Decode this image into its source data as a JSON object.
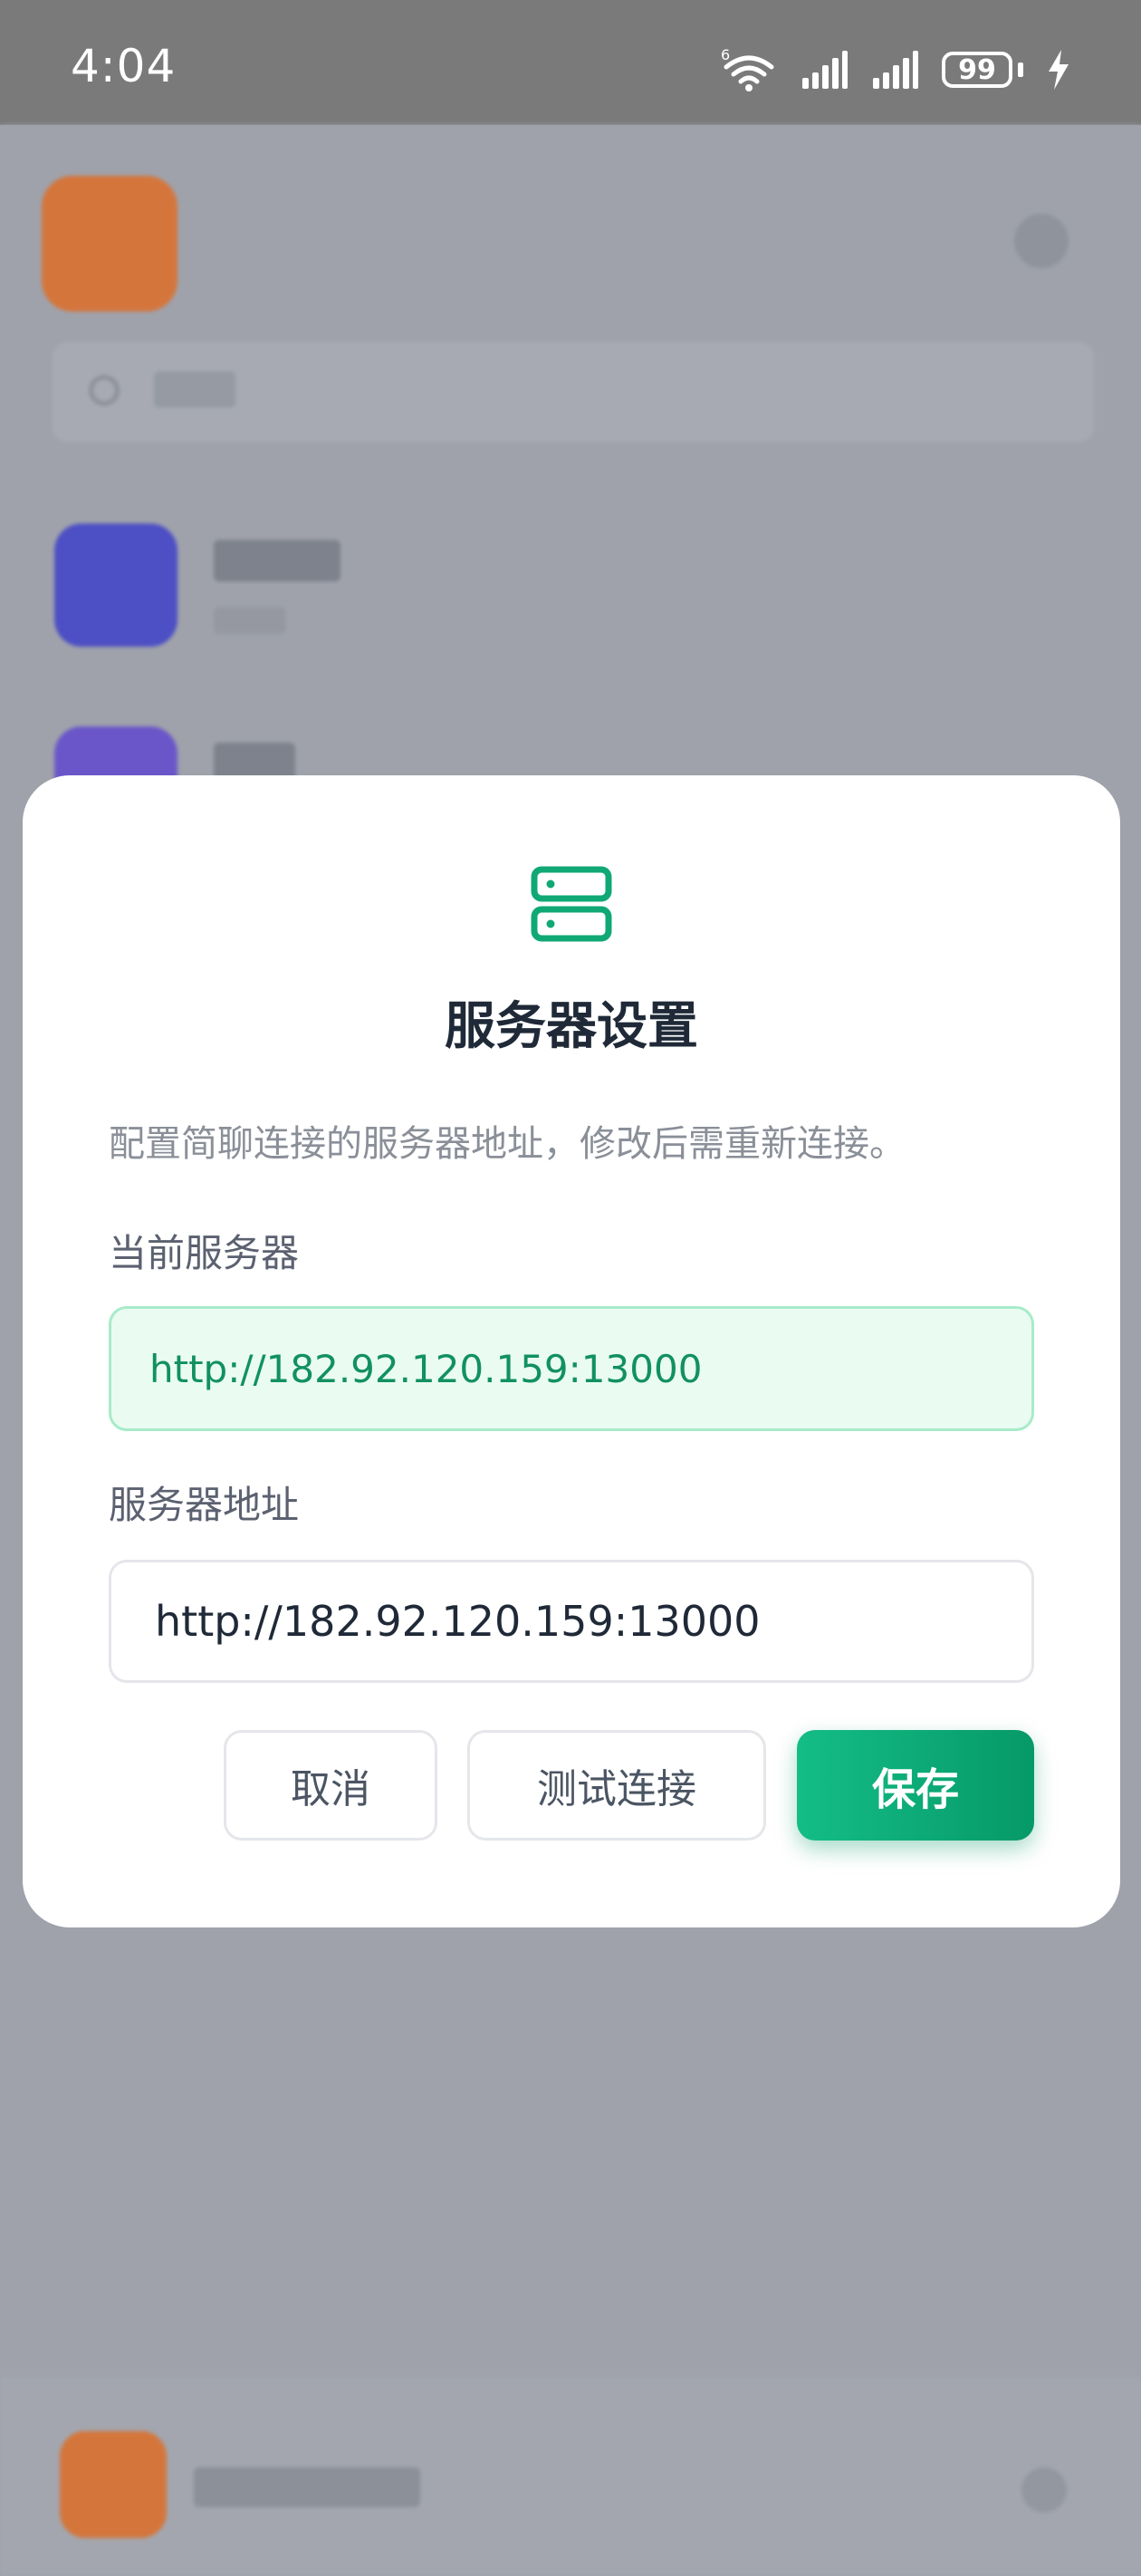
{
  "status_bar": {
    "time": "4:04",
    "battery_level": "99",
    "wifi_badge": "6"
  },
  "dialog": {
    "title": "服务器设置",
    "description": "配置简聊连接的服务器地址，修改后需重新连接。",
    "current_server_label": "当前服务器",
    "current_server_value": "http://182.92.120.159:13000",
    "address_label": "服务器地址",
    "address_value": "http://182.92.120.159:13000",
    "cancel_label": "取消",
    "test_label": "测试连接",
    "save_label": "保存"
  },
  "colors": {
    "accent": "#10a874",
    "accent_light_bg": "#eafbf2",
    "title_text": "#1f2937",
    "muted_text": "#8a8f98"
  }
}
